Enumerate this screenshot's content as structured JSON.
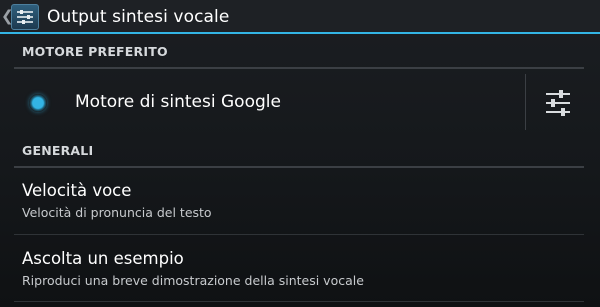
{
  "actionbar": {
    "title": "Output sintesi vocale",
    "accent_color": "#33b5e5",
    "up_icon": "chevron-left-icon",
    "app_icon": "sliders-icon"
  },
  "sections": {
    "preferred_engine": "MOTORE PREFERITO",
    "general": "GENERALI"
  },
  "engine": {
    "label": "Motore di sintesi Google",
    "selected": true,
    "settings_icon": "sliders-icon"
  },
  "preferences": [
    {
      "title": "Velocità voce",
      "summary": "Velocità di pronuncia del testo"
    },
    {
      "title": "Ascolta un esempio",
      "summary": "Riproduci una breve dimostrazione della sintesi vocale"
    }
  ]
}
